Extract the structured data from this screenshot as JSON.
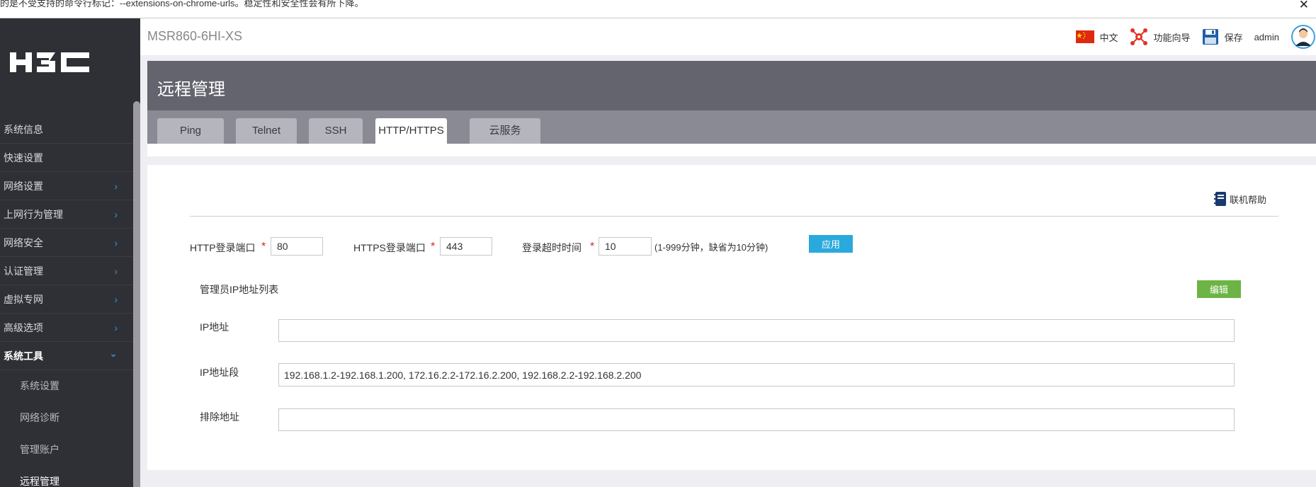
{
  "warning_bar": {
    "text": "的是不受支持的命令行标记：--extensions-on-chrome-urls。稳定性和安全性会有所下降。",
    "close_symbol": "✕"
  },
  "header": {
    "device_name": "MSR860-6HI-XS",
    "language_label": "中文",
    "wizard_label": "功能向导",
    "save_label": "保存",
    "user_label": "admin"
  },
  "sidebar": {
    "items": [
      {
        "label": "系统信息",
        "expandable": false
      },
      {
        "label": "快速设置",
        "expandable": false
      },
      {
        "label": "网络设置",
        "expandable": true
      },
      {
        "label": "上网行为管理",
        "expandable": true
      },
      {
        "label": "网络安全",
        "expandable": true
      },
      {
        "label": "认证管理",
        "expandable": true
      },
      {
        "label": "虚拟专网",
        "expandable": true
      },
      {
        "label": "高级选项",
        "expandable": true
      },
      {
        "label": "系统工具",
        "expandable": true,
        "expanded": true
      }
    ],
    "subitems": [
      "系统设置",
      "网络诊断",
      "管理账户",
      "远程管理"
    ],
    "current_subitem": "远程管理"
  },
  "page": {
    "title": "远程管理",
    "tabs": [
      "Ping",
      "Telnet",
      "SSH",
      "HTTP/HTTPS",
      "云服务"
    ],
    "active_tab": "HTTP/HTTPS",
    "help_label": "联机帮助"
  },
  "form": {
    "http_port_label": "HTTP登录端口",
    "http_port_value": "80",
    "https_port_label": "HTTPS登录端口",
    "https_port_value": "443",
    "timeout_label": "登录超时时间",
    "timeout_value": "10",
    "timeout_hint": "(1-999分钟，缺省为10分钟)",
    "required_mark": "*",
    "apply_label": "应用",
    "ip_list_title": "管理员IP地址列表",
    "edit_label": "编辑",
    "ip_address_label": "IP地址",
    "ip_address_value": "",
    "ip_range_label": "IP地址段",
    "ip_range_value": "192.168.1.2-192.168.1.200, 172.16.2.2-172.16.2.200, 192.168.2.2-192.168.2.200",
    "exclude_label": "排除地址",
    "exclude_value": ""
  },
  "colors": {
    "sidebar_bg": "#2f3035",
    "title_bg": "#64646f",
    "tabbar_bg": "#8a8a94",
    "apply_button": "#2aa9dc",
    "edit_button": "#6cb445",
    "chevron": "#3f8fd0"
  },
  "icons": {
    "flag": "china-flag-icon",
    "wizard": "wizard-icon",
    "save": "floppy-disk-icon",
    "avatar": "user-avatar-icon",
    "help": "help-book-icon",
    "chevron_right": "›",
    "chevron_down": "⌄"
  }
}
